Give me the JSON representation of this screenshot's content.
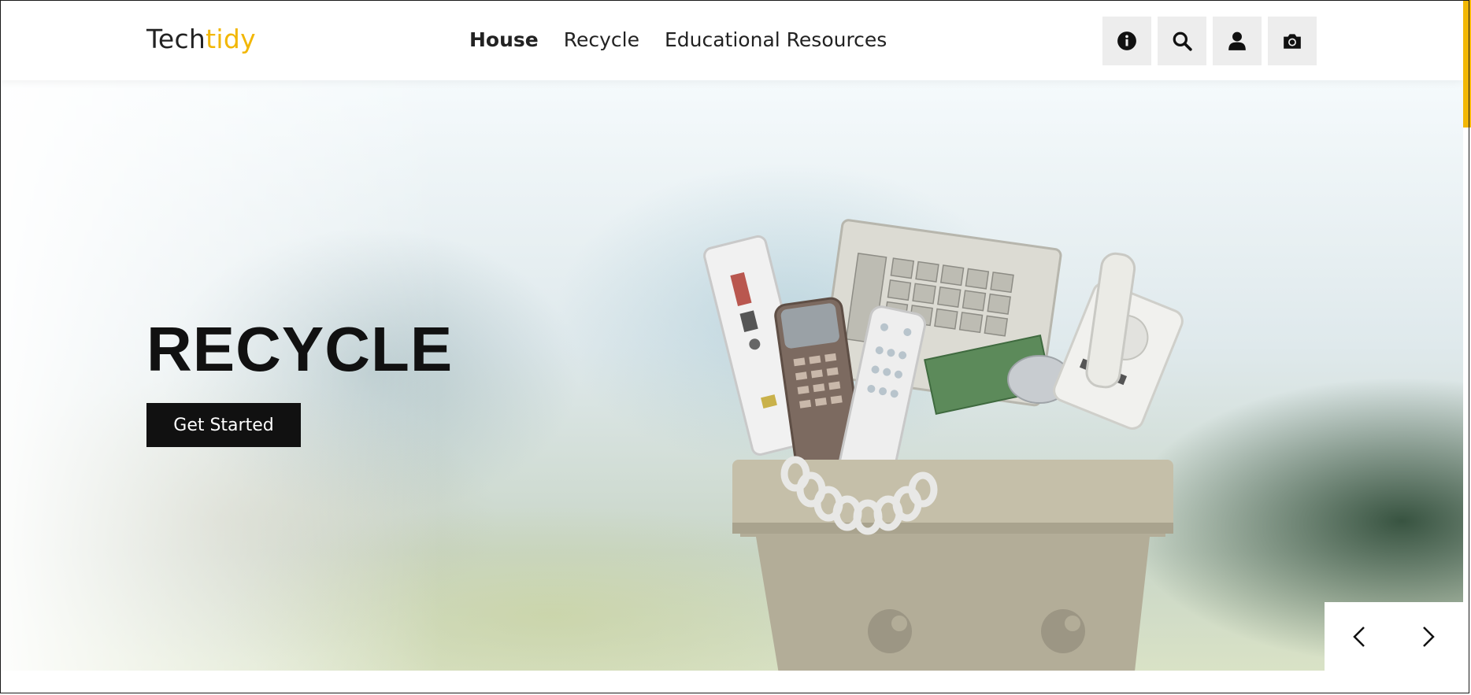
{
  "brand": {
    "name_part1": "Tech",
    "name_part2": "tidy",
    "accent_color": "#f2b705"
  },
  "nav": {
    "items": [
      {
        "label": "House",
        "active": true
      },
      {
        "label": "Recycle",
        "active": false
      },
      {
        "label": "Educational Resources",
        "active": false
      }
    ]
  },
  "header_icons": [
    "info-icon",
    "search-icon",
    "user-icon",
    "camera-icon"
  ],
  "hero": {
    "title": "RECYCLE",
    "cta_label": "Get Started"
  },
  "slider": {
    "prev_icon": "chevron-left-icon",
    "next_icon": "chevron-right-icon"
  }
}
